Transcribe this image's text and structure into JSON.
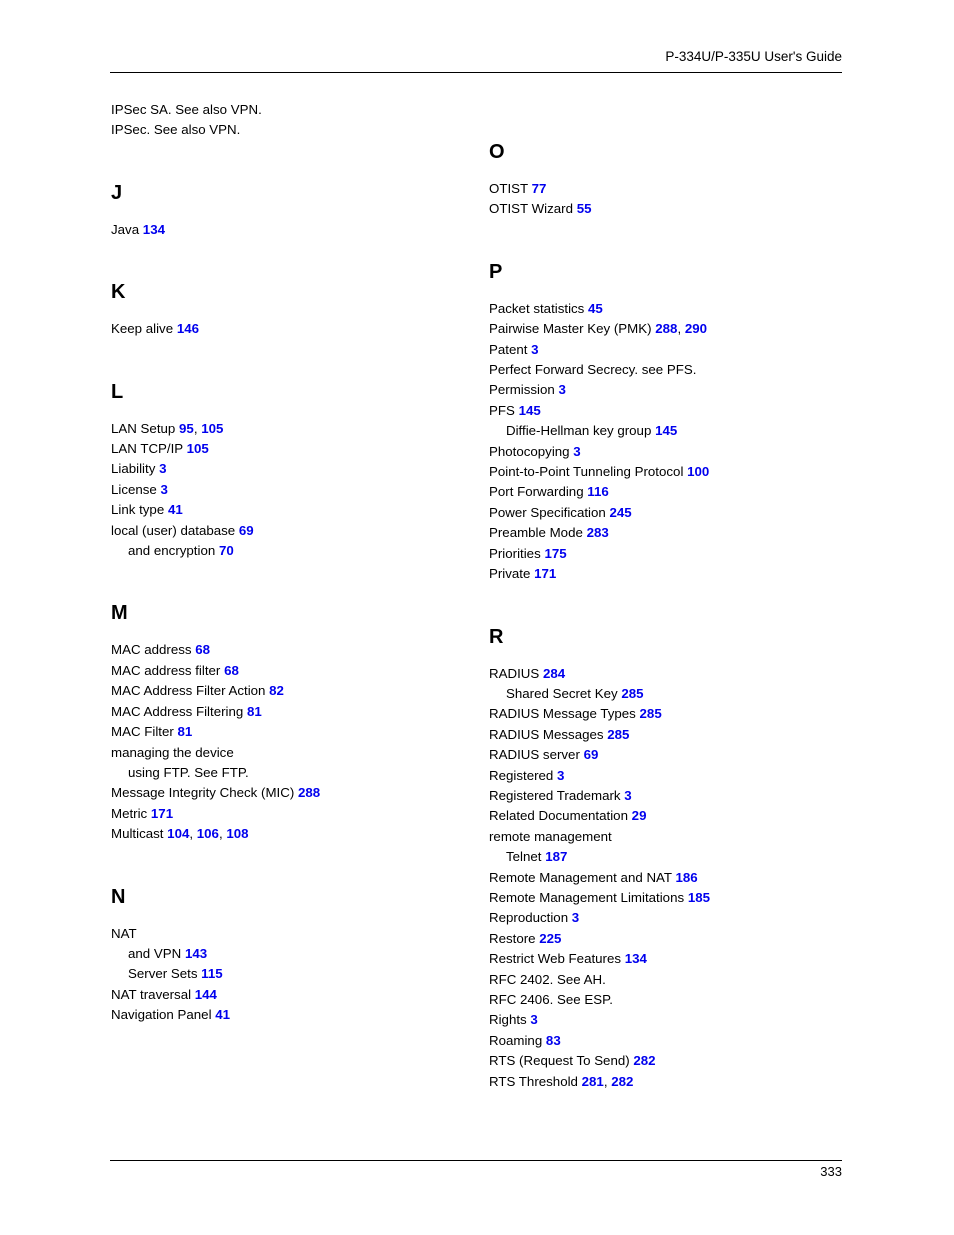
{
  "header": {
    "title": "P-334U/P-335U User's Guide"
  },
  "footer": {
    "page_number": "333"
  },
  "colors": {
    "page_link": "#0000ee",
    "text": "#000000",
    "rule": "#000000"
  },
  "index": {
    "left_column": {
      "lead_entries": [
        {
          "text": "IPSec SA. See also VPN.",
          "pages": [],
          "level": 0
        },
        {
          "text": "IPSec. See also VPN.",
          "pages": [],
          "level": 0
        }
      ],
      "sections": [
        {
          "letter": "J",
          "entries": [
            {
              "text": "Java",
              "pages": [
                "134"
              ],
              "level": 0
            }
          ]
        },
        {
          "letter": "K",
          "entries": [
            {
              "text": "Keep alive",
              "pages": [
                "146"
              ],
              "level": 0
            }
          ]
        },
        {
          "letter": "L",
          "entries": [
            {
              "text": "LAN Setup",
              "pages": [
                "95",
                "105"
              ],
              "level": 0
            },
            {
              "text": "LAN TCP/IP",
              "pages": [
                "105"
              ],
              "level": 0
            },
            {
              "text": "Liability",
              "pages": [
                "3"
              ],
              "level": 0
            },
            {
              "text": "License",
              "pages": [
                "3"
              ],
              "level": 0
            },
            {
              "text": "Link type",
              "pages": [
                "41"
              ],
              "level": 0
            },
            {
              "text": "local (user) database",
              "pages": [
                "69"
              ],
              "level": 0
            },
            {
              "text": "and encryption",
              "pages": [
                "70"
              ],
              "level": 1
            }
          ]
        },
        {
          "letter": "M",
          "entries": [
            {
              "text": "MAC address",
              "pages": [
                "68"
              ],
              "level": 0
            },
            {
              "text": "MAC address filter",
              "pages": [
                "68"
              ],
              "level": 0
            },
            {
              "text": "MAC Address Filter Action",
              "pages": [
                "82"
              ],
              "level": 0
            },
            {
              "text": "MAC Address Filtering",
              "pages": [
                "81"
              ],
              "level": 0
            },
            {
              "text": "MAC Filter",
              "pages": [
                "81"
              ],
              "level": 0
            },
            {
              "text": "managing the device",
              "pages": [],
              "level": 0
            },
            {
              "text": "using FTP. See FTP.",
              "pages": [],
              "level": 1
            },
            {
              "text": "Message Integrity Check (MIC)",
              "pages": [
                "288"
              ],
              "level": 0
            },
            {
              "text": "Metric",
              "pages": [
                "171"
              ],
              "level": 0
            },
            {
              "text": "Multicast",
              "pages": [
                "104",
                "106",
                "108"
              ],
              "level": 0
            }
          ]
        },
        {
          "letter": "N",
          "entries": [
            {
              "text": "NAT",
              "pages": [],
              "level": 0
            },
            {
              "text": "and VPN",
              "pages": [
                "143"
              ],
              "level": 1
            },
            {
              "text": "Server Sets",
              "pages": [
                "115"
              ],
              "level": 1
            },
            {
              "text": "NAT traversal",
              "pages": [
                "144"
              ],
              "level": 0
            },
            {
              "text": "Navigation Panel",
              "pages": [
                "41"
              ],
              "level": 0
            }
          ]
        }
      ]
    },
    "right_column": {
      "lead_entries": [],
      "sections": [
        {
          "letter": "O",
          "entries": [
            {
              "text": "OTIST",
              "pages": [
                "77"
              ],
              "level": 0
            },
            {
              "text": "OTIST Wizard",
              "pages": [
                "55"
              ],
              "level": 0
            }
          ]
        },
        {
          "letter": "P",
          "entries": [
            {
              "text": "Packet statistics",
              "pages": [
                "45"
              ],
              "level": 0
            },
            {
              "text": "Pairwise Master Key (PMK)",
              "pages": [
                "288",
                "290"
              ],
              "level": 0
            },
            {
              "text": "Patent",
              "pages": [
                "3"
              ],
              "level": 0
            },
            {
              "text": "Perfect Forward Secrecy. see PFS.",
              "pages": [],
              "level": 0
            },
            {
              "text": "Permission",
              "pages": [
                "3"
              ],
              "level": 0
            },
            {
              "text": "PFS",
              "pages": [
                "145"
              ],
              "level": 0
            },
            {
              "text": "Diffie-Hellman key group",
              "pages": [
                "145"
              ],
              "level": 1
            },
            {
              "text": "Photocopying",
              "pages": [
                "3"
              ],
              "level": 0
            },
            {
              "text": "Point-to-Point Tunneling Protocol",
              "pages": [
                "100"
              ],
              "level": 0
            },
            {
              "text": "Port Forwarding",
              "pages": [
                "116"
              ],
              "level": 0
            },
            {
              "text": "Power Specification",
              "pages": [
                "245"
              ],
              "level": 0
            },
            {
              "text": "Preamble Mode",
              "pages": [
                "283"
              ],
              "level": 0
            },
            {
              "text": "Priorities",
              "pages": [
                "175"
              ],
              "level": 0
            },
            {
              "text": "Private",
              "pages": [
                "171"
              ],
              "level": 0
            }
          ]
        },
        {
          "letter": "R",
          "entries": [
            {
              "text": "RADIUS",
              "pages": [
                "284"
              ],
              "level": 0
            },
            {
              "text": "Shared Secret Key",
              "pages": [
                "285"
              ],
              "level": 1
            },
            {
              "text": "RADIUS Message Types",
              "pages": [
                "285"
              ],
              "level": 0
            },
            {
              "text": "RADIUS Messages",
              "pages": [
                "285"
              ],
              "level": 0
            },
            {
              "text": "RADIUS server",
              "pages": [
                "69"
              ],
              "level": 0
            },
            {
              "text": "Registered",
              "pages": [
                "3"
              ],
              "level": 0
            },
            {
              "text": "Registered Trademark",
              "pages": [
                "3"
              ],
              "level": 0
            },
            {
              "text": "Related Documentation",
              "pages": [
                "29"
              ],
              "level": 0
            },
            {
              "text": "remote management",
              "pages": [],
              "level": 0
            },
            {
              "text": "Telnet",
              "pages": [
                "187"
              ],
              "level": 1
            },
            {
              "text": "Remote Management and NAT",
              "pages": [
                "186"
              ],
              "level": 0
            },
            {
              "text": "Remote Management Limitations",
              "pages": [
                "185"
              ],
              "level": 0
            },
            {
              "text": "Reproduction",
              "pages": [
                "3"
              ],
              "level": 0
            },
            {
              "text": "Restore",
              "pages": [
                "225"
              ],
              "level": 0
            },
            {
              "text": "Restrict Web Features",
              "pages": [
                "134"
              ],
              "level": 0
            },
            {
              "text": "RFC 2402. See AH.",
              "pages": [],
              "level": 0
            },
            {
              "text": "RFC 2406. See ESP.",
              "pages": [],
              "level": 0
            },
            {
              "text": "Rights",
              "pages": [
                "3"
              ],
              "level": 0
            },
            {
              "text": "Roaming",
              "pages": [
                "83"
              ],
              "level": 0
            },
            {
              "text": "RTS (Request To Send)",
              "pages": [
                "282"
              ],
              "level": 0
            },
            {
              "text": "RTS Threshold",
              "pages": [
                "281",
                "282"
              ],
              "level": 0
            }
          ]
        }
      ]
    }
  }
}
